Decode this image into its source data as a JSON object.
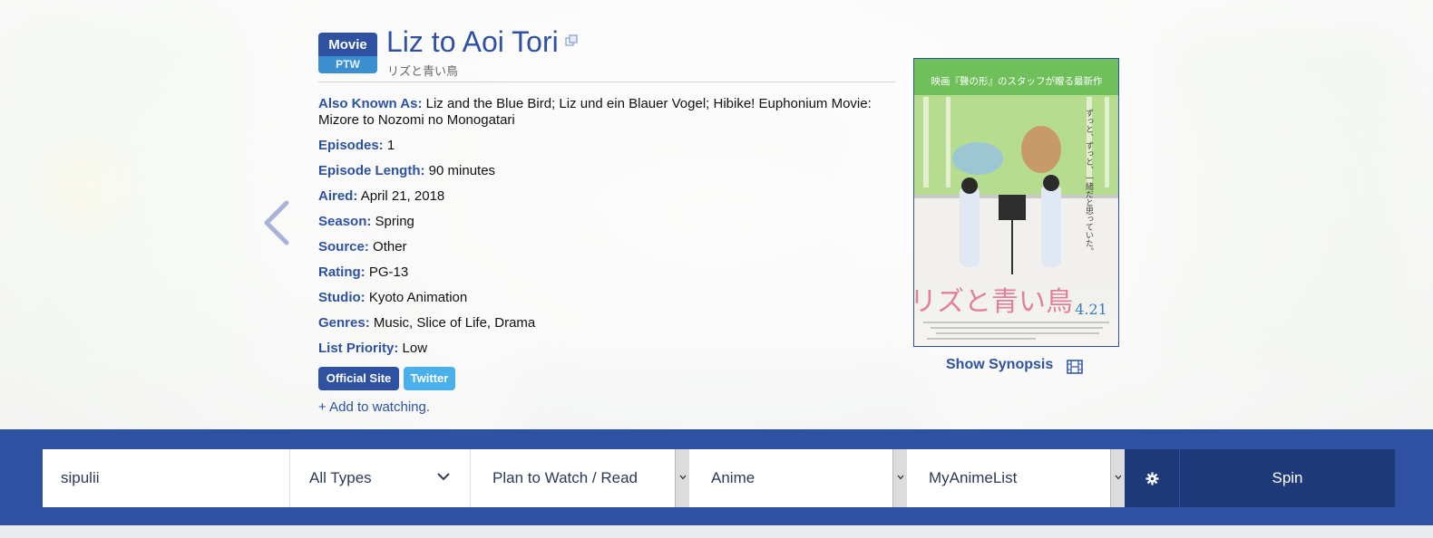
{
  "entry": {
    "type_badge": "Movie",
    "list_badge": "PTW",
    "title": "Liz to Aoi Tori",
    "alt_title": "リズと青い鳥",
    "fields": [
      {
        "key": "Also Known As:",
        "value": "Liz and the Blue Bird; Liz und ein Blauer Vogel; Hibike! Euphonium Movie: Mizore to Nozomi no Monogatari"
      },
      {
        "key": "Episodes:",
        "value": "1"
      },
      {
        "key": "Episode Length:",
        "value": "90 minutes"
      },
      {
        "key": "Aired:",
        "value": "April 21, 2018"
      },
      {
        "key": "Season:",
        "value": "Spring"
      },
      {
        "key": "Source:",
        "value": "Other"
      },
      {
        "key": "Rating:",
        "value": "PG-13"
      },
      {
        "key": "Studio:",
        "value": "Kyoto Animation"
      },
      {
        "key": "Genres:",
        "value": "Music, Slice of Life, Drama"
      },
      {
        "key": "List Priority:",
        "value": "Low"
      }
    ],
    "links": {
      "official": "Official Site",
      "twitter": "Twitter"
    },
    "add_link": "+ Add to watching.",
    "show_synopsis": "Show Synopsis",
    "poster": {
      "top_text": "映画『聲の形』のスタッフが贈る最新作",
      "title_text": "リズと青い鳥",
      "date_text": "4.21",
      "vertical_text": "ずっと、ずっと、一緒だと思っていた。"
    }
  },
  "controls": {
    "username": "sipulii",
    "type_select": "All Types",
    "status_select": "Plan to Watch / Read",
    "media_select": "Anime",
    "site_select": "MyAnimeList",
    "spin_label": "Spin"
  },
  "colors": {
    "brand": "#2e51a2",
    "brand_dark": "#1f3a78",
    "twitter": "#4ab0ec",
    "badge_secondary": "#3b8ed0"
  },
  "icons": [
    "chevron-left-icon",
    "copy-icon",
    "film-icon",
    "chevron-down-icon",
    "gear-icon"
  ]
}
